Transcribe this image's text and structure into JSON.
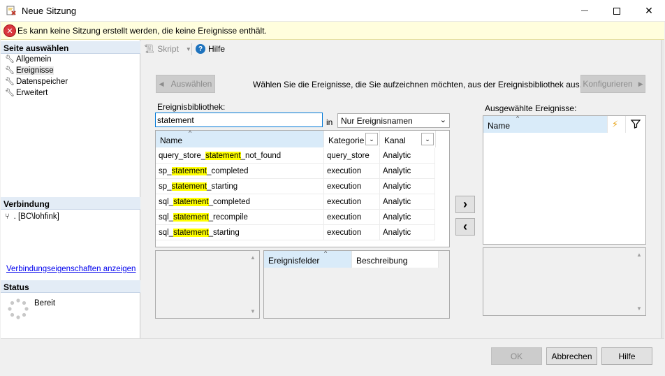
{
  "window": {
    "title": "Neue Sitzung",
    "minimize_glyph": "—",
    "maximize_glyph": "☐",
    "close_glyph": "✕"
  },
  "error_banner": {
    "icon": "error-icon",
    "text": "Es kann keine Sitzung erstellt werden, die keine Ereignisse enthält."
  },
  "sidebar": {
    "select_page_header": "Seite auswählen",
    "items": [
      {
        "label": "Allgemein",
        "icon": "wrench-icon"
      },
      {
        "label": "Ereignisse",
        "icon": "wrench-icon",
        "selected": true
      },
      {
        "label": "Datenspeicher",
        "icon": "wrench-icon"
      },
      {
        "label": "Erweitert",
        "icon": "wrench-icon"
      }
    ],
    "connection_header": "Verbindung",
    "connection_value": ". [BC\\lohfink]",
    "connection_link": "Verbindungseigenschaften anzeigen",
    "status_header": "Status",
    "status_value": "Bereit"
  },
  "toolbar": {
    "script_label": "Skript",
    "help_label": "Hilfe"
  },
  "events": {
    "select_button": "Auswählen",
    "instruction": "Wählen Sie die Ereignisse, die Sie aufzeichnen möchten, aus der Ereignisbibliothek aus.",
    "configure_button": "Konfigurieren",
    "library_label": "Ereignisbibliothek:",
    "search_value": "statement",
    "in_label": "in",
    "filter_select_value": "Nur Ereignisnamen",
    "columns": {
      "name": "Name",
      "category": "Kategorie",
      "channel": "Kanal"
    },
    "rows": [
      {
        "pre": "query_store_",
        "hit": "statement",
        "post": "_not_found",
        "category": "query_store",
        "channel": "Analytic"
      },
      {
        "pre": "sp_",
        "hit": "statement",
        "post": "_completed",
        "category": "execution",
        "channel": "Analytic"
      },
      {
        "pre": "sp_",
        "hit": "statement",
        "post": "_starting",
        "category": "execution",
        "channel": "Analytic"
      },
      {
        "pre": "sql_",
        "hit": "statement",
        "post": "_completed",
        "category": "execution",
        "channel": "Analytic"
      },
      {
        "pre": "sql_",
        "hit": "statement",
        "post": "_recompile",
        "category": "execution",
        "channel": "Analytic"
      },
      {
        "pre": "sql_",
        "hit": "statement",
        "post": "_starting",
        "category": "execution",
        "channel": "Analytic"
      }
    ],
    "fields_columns": {
      "fields": "Ereignisfelder",
      "description": "Beschreibung"
    },
    "selected_label": "Ausgewählte Ereignisse:",
    "selected_columns": {
      "name": "Name"
    },
    "add_glyph": "›",
    "remove_glyph": "‹"
  },
  "footer": {
    "ok": "OK",
    "cancel": "Abbrechen",
    "help": "Hilfe"
  },
  "colors": {
    "highlight": "#ffff00",
    "section_header": "#e3ecf6",
    "error_banner": "#fffedd",
    "link": "#0000ee"
  }
}
